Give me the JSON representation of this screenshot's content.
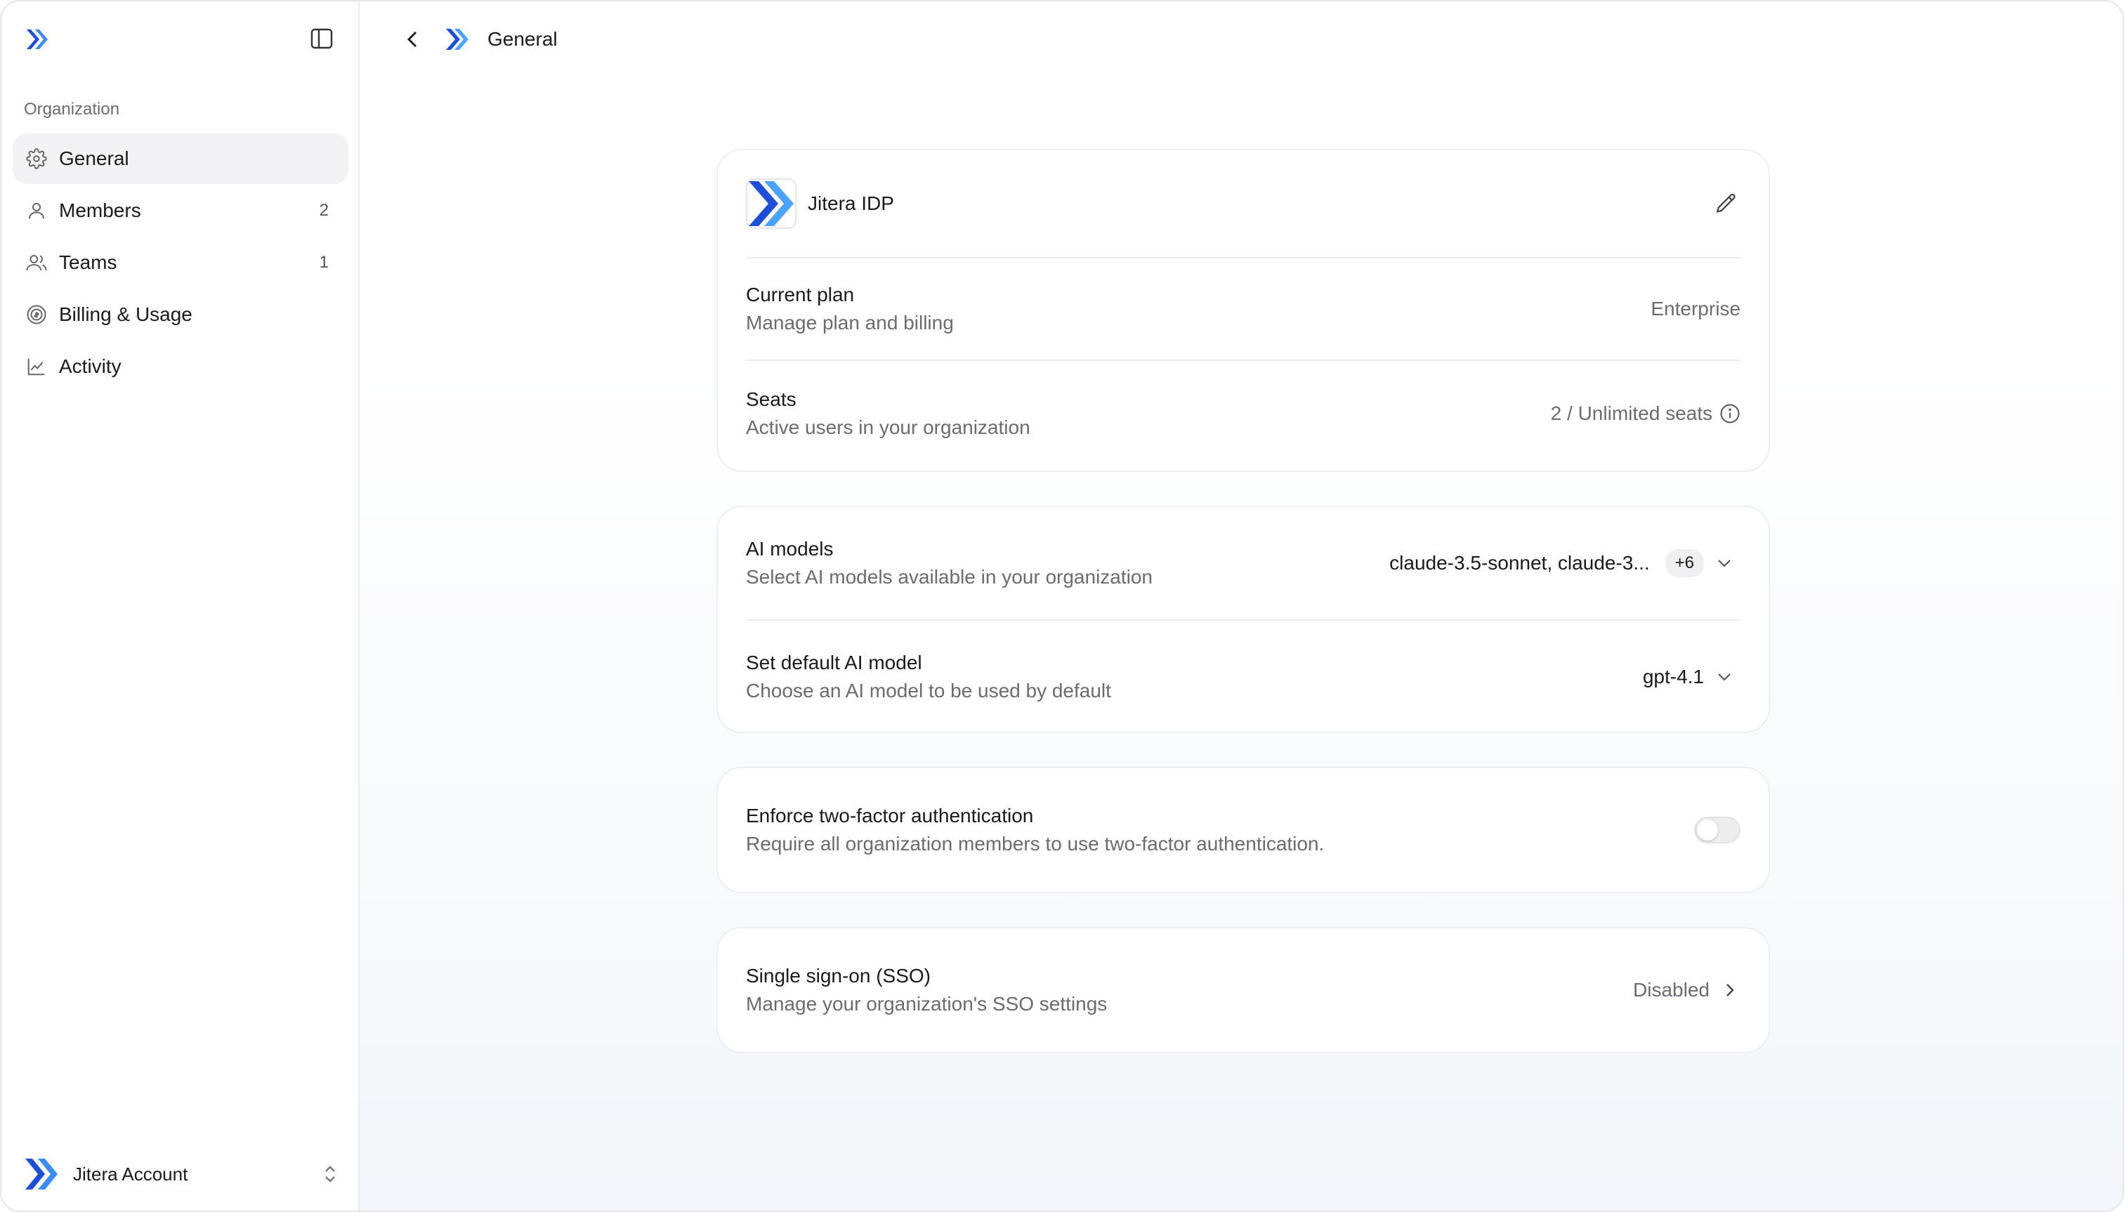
{
  "sidebar": {
    "section_label": "Organization",
    "items": [
      {
        "label": "General",
        "count": "",
        "icon": "gear-icon",
        "active": true
      },
      {
        "label": "Members",
        "count": "2",
        "icon": "user-icon"
      },
      {
        "label": "Teams",
        "count": "1",
        "icon": "users-icon"
      },
      {
        "label": "Billing & Usage",
        "count": "",
        "icon": "billing-icon"
      },
      {
        "label": "Activity",
        "count": "",
        "icon": "chart-line-icon"
      }
    ],
    "account": {
      "name": "Jitera Account"
    }
  },
  "header": {
    "title": "General"
  },
  "org": {
    "name": "Jitera IDP"
  },
  "plan": {
    "title": "Current plan",
    "subtitle": "Manage plan and billing",
    "value": "Enterprise"
  },
  "seats": {
    "title": "Seats",
    "subtitle": "Active users in your organization",
    "value": "2 / Unlimited seats"
  },
  "ai_models": {
    "title": "AI models",
    "subtitle": "Select AI models available in your organization",
    "value": "claude-3.5-sonnet, claude-3...",
    "extra": "+6"
  },
  "default_model": {
    "title": "Set default AI model",
    "subtitle": "Choose an AI model to be used by default",
    "value": "gpt-4.1"
  },
  "two_factor": {
    "title": "Enforce two-factor authentication",
    "subtitle": "Require all organization members to use two-factor authentication.",
    "enabled": false
  },
  "sso": {
    "title": "Single sign-on (SSO)",
    "subtitle": "Manage your organization's SSO settings",
    "value": "Disabled"
  },
  "colors": {
    "brand_dark": "#1d4ed8",
    "brand_light": "#4aa3ff"
  }
}
